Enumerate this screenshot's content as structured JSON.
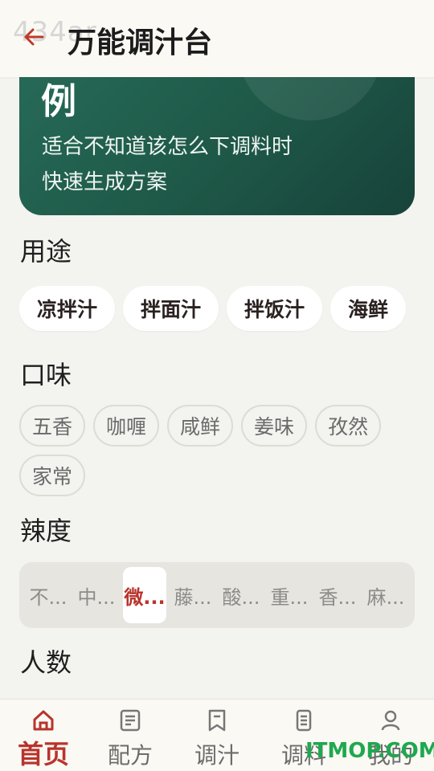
{
  "header": {
    "watermark": "434ar",
    "title": "万能调汁台"
  },
  "banner": {
    "heading": "例",
    "line1": "适合不知道该怎么下调料时",
    "line2": "快速生成方案"
  },
  "sections": {
    "usage_label": "用途",
    "flavor_label": "口味",
    "spice_label": "辣度",
    "people_label": "人数"
  },
  "usage_chips": [
    "凉拌汁",
    "拌面汁",
    "拌饭汁",
    "海鲜"
  ],
  "flavor_chips": [
    "五香",
    "咖喱",
    "咸鲜",
    "姜味",
    "孜然",
    "家常"
  ],
  "spice_levels": [
    "不...",
    "中...",
    "微...",
    "藤...",
    "酸...",
    "重...",
    "香...",
    "麻..."
  ],
  "spice_selected_index": 2,
  "bottom_nav": [
    {
      "label": "首页",
      "icon": "home-icon",
      "active": true
    },
    {
      "label": "配方",
      "icon": "recipe-icon",
      "active": false
    },
    {
      "label": "调汁",
      "icon": "bookmark-icon",
      "active": false
    },
    {
      "label": "调料",
      "icon": "jar-icon",
      "active": false
    },
    {
      "label": "我的",
      "icon": "profile-icon",
      "active": false
    }
  ],
  "brand_watermark": "ITMOP.COM",
  "colors": {
    "accent": "#b8342b",
    "banner": "#1f5a49",
    "watermark_green": "#1fa84f"
  }
}
